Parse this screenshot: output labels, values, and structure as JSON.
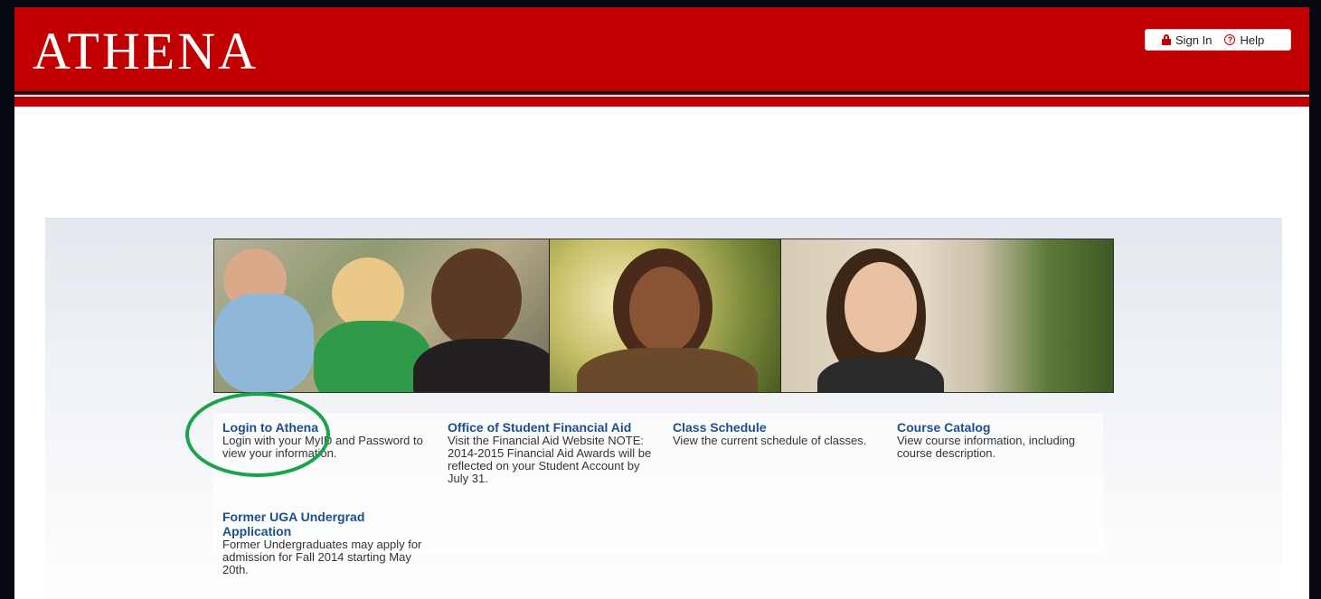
{
  "header": {
    "wordmark": "ATHENA",
    "sign_in_label": "Sign In",
    "help_label": "Help",
    "accent_color": "#c00000"
  },
  "icons": {
    "sign_in": "lock-icon",
    "help": "help-circle-icon"
  },
  "links": [
    {
      "title": "Login to Athena",
      "description": "Login with your MyID and Password to view your information."
    },
    {
      "title": "Office of Student Financial Aid",
      "description": "Visit the Financial Aid Website NOTE: 2014-2015 Financial Aid Awards will be reflected on your Student Account by July 31."
    },
    {
      "title": "Class Schedule",
      "description": "View the current schedule of classes."
    },
    {
      "title": "Course Catalog",
      "description": "View course information, including course description."
    },
    {
      "title": "Former UGA Undergrad Application",
      "description": "Former Undergraduates may apply for admission for Fall 2014 starting May 20th."
    }
  ],
  "annotation": {
    "highlight_color": "#1aa34a"
  }
}
